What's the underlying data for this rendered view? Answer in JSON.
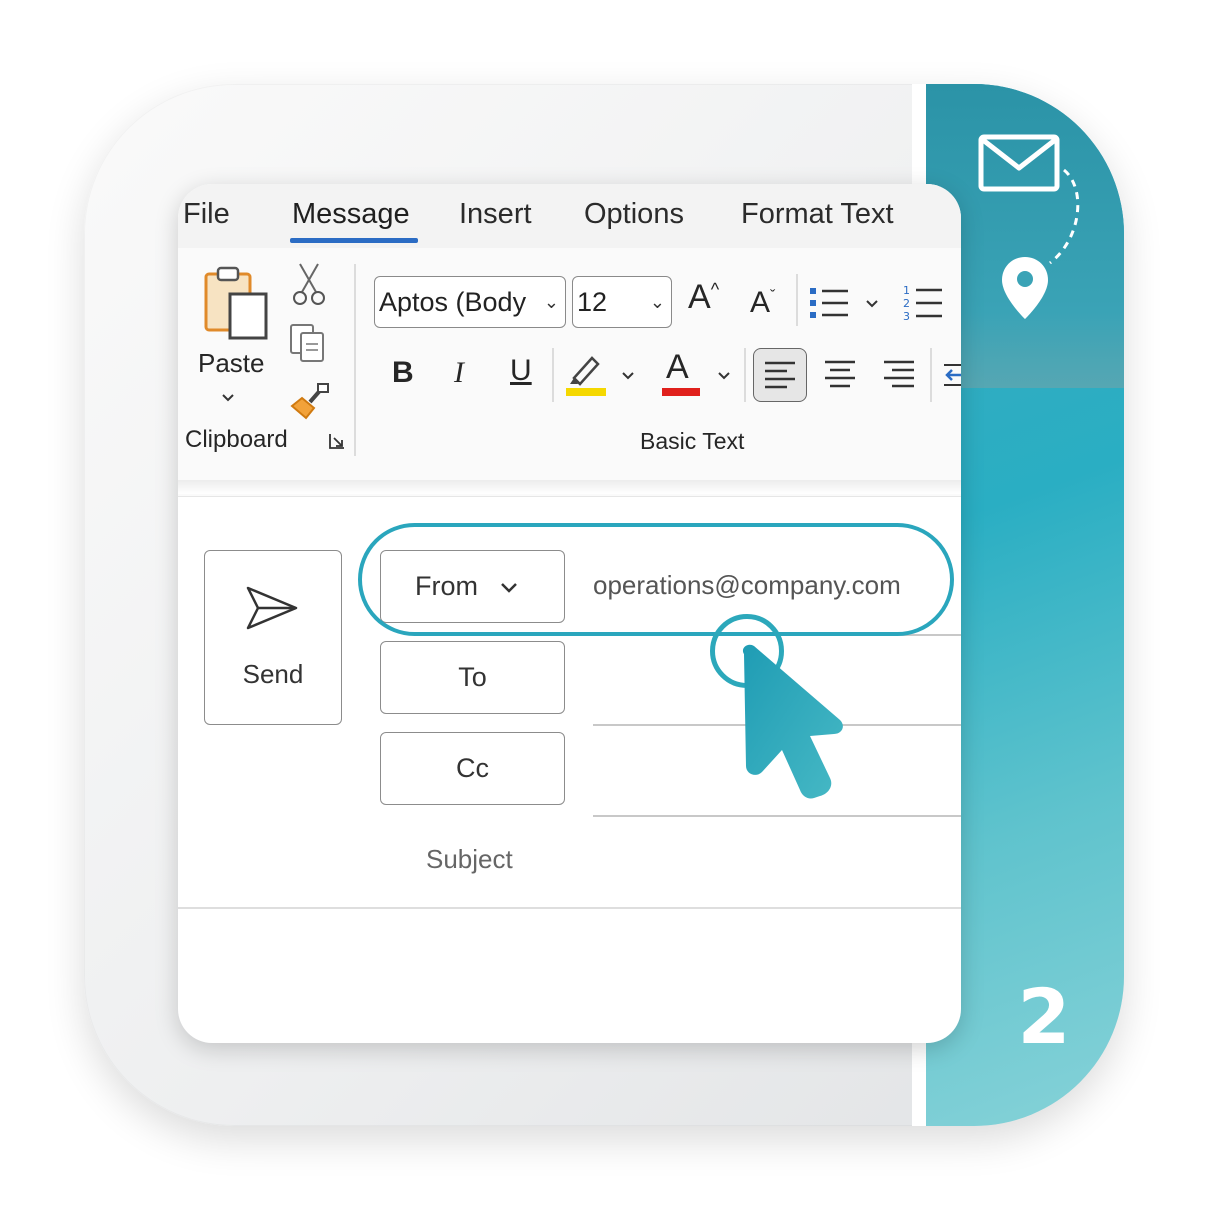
{
  "ribbon_tabs": [
    "File",
    "Message",
    "Insert",
    "Options",
    "Format Text"
  ],
  "active_tab": "Message",
  "clipboard": {
    "paste_label": "Paste",
    "group_label": "Clipboard"
  },
  "basic_text": {
    "font_name": "Aptos (Body",
    "font_size": "12",
    "group_label": "Basic Text"
  },
  "formatting": {
    "bold": "B",
    "italic": "I",
    "underline": "U",
    "font_color_letter": "A",
    "grow_font": "A",
    "shrink_font": "A"
  },
  "compose": {
    "send_label": "Send",
    "from_label": "From",
    "from_value": "operations@company.com",
    "to_label": "To",
    "cc_label": "Cc",
    "subject_label": "Subject"
  },
  "step": {
    "number": "2"
  },
  "colors": {
    "accent": "#2aa6bd",
    "highlight_yellow": "#f5d800",
    "font_red": "#e0201c",
    "active_tab": "#2b6cc4"
  },
  "icons": [
    "envelope-icon",
    "location-pin-icon",
    "paste-icon",
    "scissors-icon",
    "copy-icon",
    "format-painter-icon",
    "bullets-icon",
    "numbering-icon",
    "highlighter-icon",
    "align-left-icon",
    "align-center-icon",
    "align-right-icon",
    "send-icon",
    "cursor-icon"
  ]
}
